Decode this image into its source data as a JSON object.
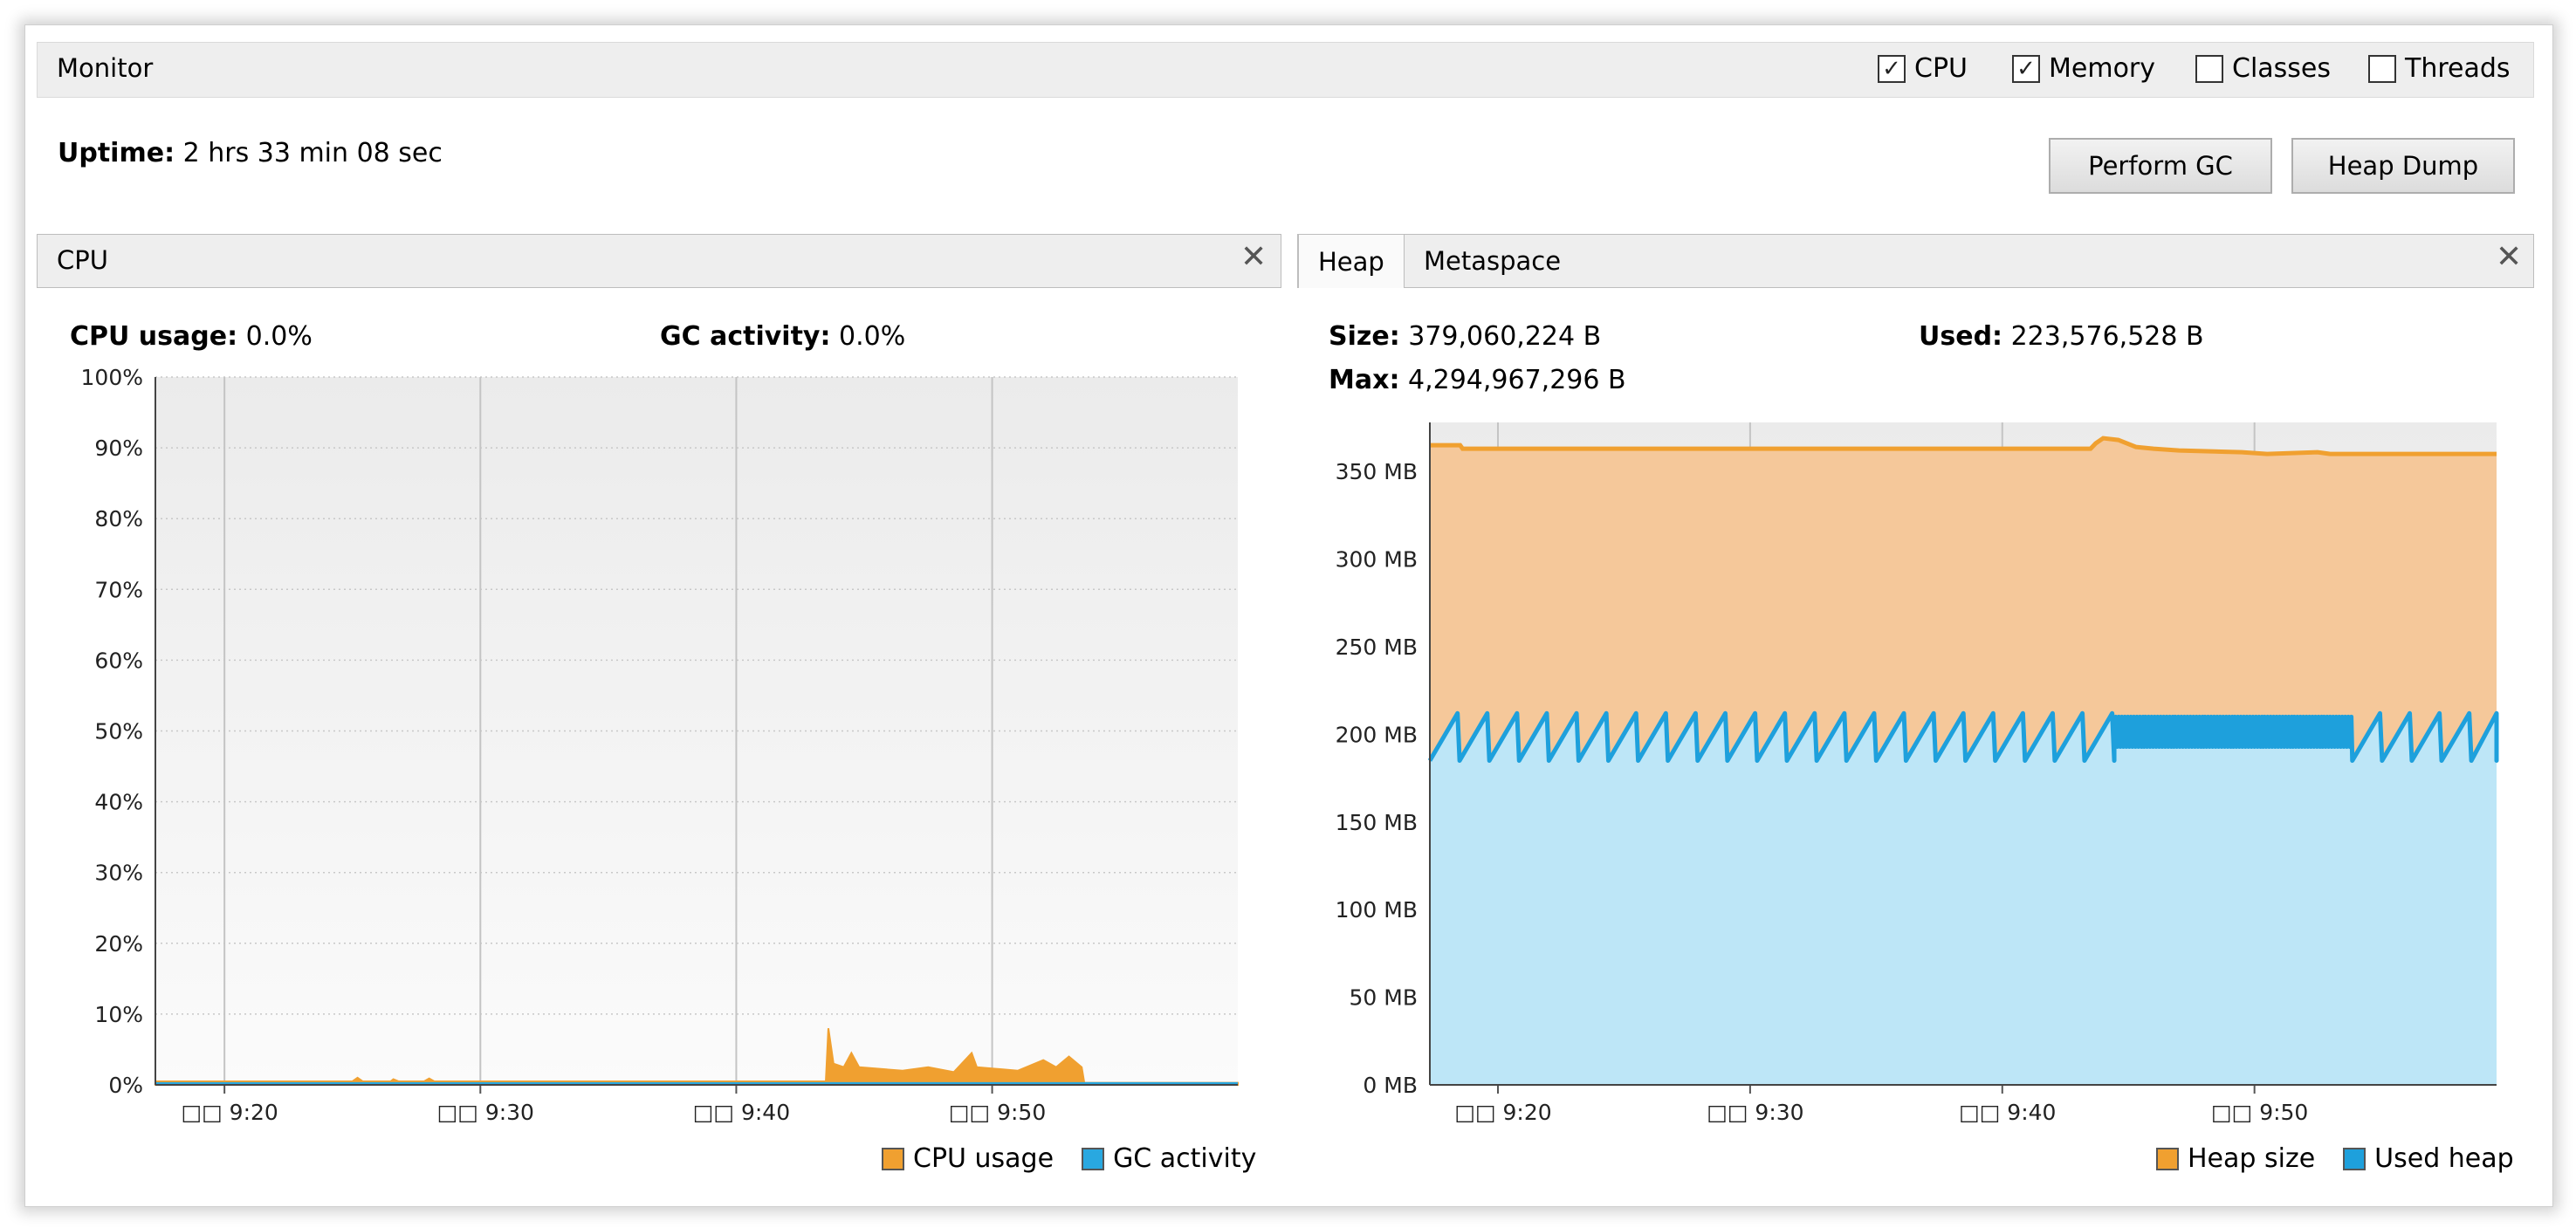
{
  "monitor": {
    "title": "Monitor",
    "checkboxes": [
      {
        "label": "CPU",
        "checked": true
      },
      {
        "label": "Memory",
        "checked": true
      },
      {
        "label": "Classes",
        "checked": false
      },
      {
        "label": "Threads",
        "checked": false
      }
    ],
    "uptime_label": "Uptime:",
    "uptime_value": "2 hrs 33 min 08 sec",
    "perform_gc": "Perform GC",
    "heap_dump": "Heap Dump"
  },
  "cpu_panel": {
    "title": "CPU",
    "close_icon": "close-icon",
    "usage_label": "CPU usage:",
    "usage_value": "0.0%",
    "gc_label": "GC activity:",
    "gc_value": "0.0%",
    "legend": [
      "CPU usage",
      "GC activity"
    ]
  },
  "heap_panel": {
    "tabs": [
      "Heap",
      "Metaspace"
    ],
    "active_tab": "Heap",
    "close_icon": "close-icon",
    "size_label": "Size:",
    "size_value": "379,060,224 B",
    "used_label": "Used:",
    "used_value": "223,576,528 B",
    "max_label": "Max:",
    "max_value": "4,294,967,296 B",
    "legend": [
      "Heap size",
      "Used heap"
    ]
  },
  "colors": {
    "cpu": "#f0a030",
    "gc": "#29a8e0",
    "heap_line": "#f0a030",
    "heap_fill": "#f5c89a",
    "used_line": "#1ea0dc",
    "used_fill": "#bde6f7"
  },
  "chart_data": [
    {
      "type": "area",
      "name": "cpu-chart",
      "x_ticks": [
        "□□ 9:20",
        "□□ 9:30",
        "□□ 9:40",
        "□□ 9:50"
      ],
      "x_tick_minutes": [
        20,
        30,
        40,
        50
      ],
      "x_range_minutes": [
        17.3,
        59.6
      ],
      "y_ticks": [
        "0%",
        "10%",
        "20%",
        "30%",
        "40%",
        "50%",
        "60%",
        "70%",
        "80%",
        "90%",
        "100%"
      ],
      "ylim": [
        0,
        100
      ],
      "series": [
        {
          "name": "CPU usage",
          "color": "#f0a030",
          "points": [
            [
              17.3,
              0.5
            ],
            [
              25.0,
              0.5
            ],
            [
              25.2,
              1.0
            ],
            [
              25.4,
              0.5
            ],
            [
              26.5,
              0.5
            ],
            [
              26.6,
              0.8
            ],
            [
              26.8,
              0.5
            ],
            [
              27.8,
              0.5
            ],
            [
              28.0,
              0.9
            ],
            [
              28.2,
              0.5
            ],
            [
              43.5,
              0.5
            ],
            [
              43.6,
              8.0
            ],
            [
              43.8,
              3.0
            ],
            [
              44.2,
              2.5
            ],
            [
              44.5,
              4.5
            ],
            [
              44.8,
              2.5
            ],
            [
              46.5,
              2.0
            ],
            [
              47.5,
              2.5
            ],
            [
              48.5,
              1.8
            ],
            [
              49.2,
              4.5
            ],
            [
              49.4,
              2.5
            ],
            [
              51.0,
              2.0
            ],
            [
              52.0,
              3.5
            ],
            [
              52.5,
              2.5
            ],
            [
              53.0,
              4.0
            ],
            [
              53.5,
              2.5
            ],
            [
              53.6,
              0.3
            ],
            [
              59.6,
              0.3
            ]
          ]
        },
        {
          "name": "GC activity",
          "color": "#29a8e0",
          "points": [
            [
              17.3,
              0.2
            ],
            [
              59.6,
              0.2
            ]
          ]
        }
      ],
      "grid": true
    },
    {
      "type": "area",
      "name": "heap-chart",
      "x_ticks": [
        "□□ 9:20",
        "□□ 9:30",
        "□□ 9:40",
        "□□ 9:50"
      ],
      "x_tick_minutes": [
        20,
        30,
        40,
        50
      ],
      "x_range_minutes": [
        17.3,
        59.6
      ],
      "y_ticks": [
        "0 MB",
        "50 MB",
        "100 MB",
        "150 MB",
        "200 MB",
        "250 MB",
        "300 MB",
        "350 MB"
      ],
      "ylim": [
        0,
        378
      ],
      "y_unit": "MB",
      "series": [
        {
          "name": "Heap size",
          "color": "#f0a030",
          "points": [
            [
              17.3,
              365
            ],
            [
              18.5,
              365
            ],
            [
              18.6,
              363
            ],
            [
              43.5,
              363
            ],
            [
              43.7,
              366
            ],
            [
              44.0,
              369
            ],
            [
              44.6,
              368
            ],
            [
              45.3,
              364
            ],
            [
              46.0,
              363
            ],
            [
              47.0,
              362
            ],
            [
              49.5,
              361
            ],
            [
              50.5,
              360
            ],
            [
              52.5,
              361
            ],
            [
              53.0,
              360
            ],
            [
              59.6,
              360
            ]
          ]
        },
        {
          "name": "Used heap",
          "color": "#1ea0dc",
          "sawtooth": {
            "start": 17.3,
            "end": 59.6,
            "period_minutes": 1.18,
            "min": 185,
            "max": 212,
            "dense_from": 43.6,
            "dense_to": 53.6
          }
        }
      ],
      "grid": true
    }
  ]
}
